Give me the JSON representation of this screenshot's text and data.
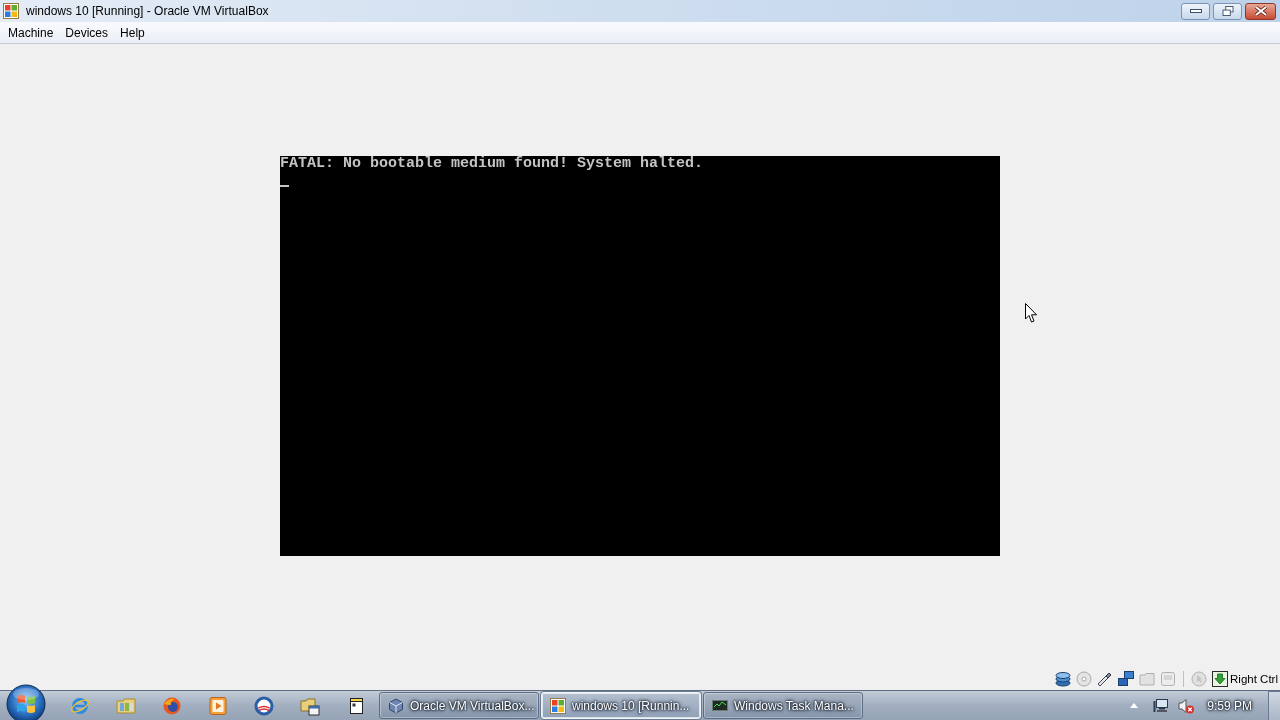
{
  "window": {
    "title": "windows 10 [Running] - Oracle VM VirtualBox"
  },
  "menu": [
    "Machine",
    "Devices",
    "Help"
  ],
  "vm_screen": {
    "lines": [
      "FATAL: No bootable medium found! System halted."
    ]
  },
  "status_bar": {
    "host_key": "Right Ctrl"
  },
  "taskbar": {
    "tasks": [
      {
        "kind": "manager",
        "label": "Oracle VM VirtualBox...",
        "selected": false
      },
      {
        "kind": "machine",
        "label": "windows 10 [Runnin...",
        "selected": true
      },
      {
        "kind": "monitor",
        "label": "Windows Task Mana...",
        "selected": false
      }
    ],
    "clock": "9:59 PM"
  }
}
